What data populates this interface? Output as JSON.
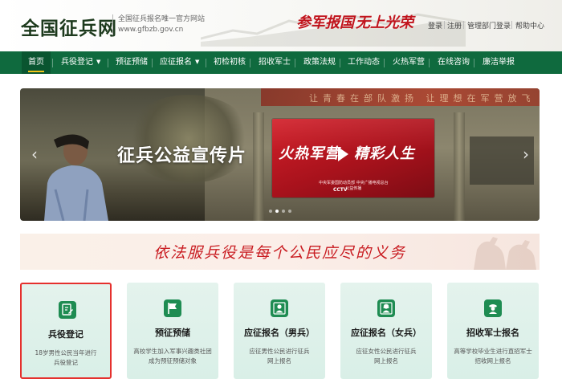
{
  "header": {
    "logo": "全国征兵网",
    "site_desc": "全国征兵报名唯一官方网站",
    "site_url": "www.gfbzb.gov.cn",
    "slogan_1": "参军报国",
    "slogan_2": "无上光荣",
    "links": [
      "登录",
      "注册",
      "管理部门登录",
      "帮助中心"
    ]
  },
  "nav": {
    "items": [
      "首页",
      "兵役登记",
      "预征预储",
      "应征报名",
      "初检初核",
      "招收军士",
      "政策法规",
      "工作动态",
      "火热军营",
      "在线咨询",
      "廉洁举报"
    ],
    "active_index": 0,
    "dropdown_items": [
      "兵役登记",
      "应征报名"
    ]
  },
  "banner": {
    "title": "征兵公益宣传片",
    "promo_title_1": "火热军营",
    "promo_title_2": "精彩人生",
    "promo_credit": "中央军委国防动员部 中央广播电视总台",
    "promo_credit_2": "公益传播",
    "promo_channel": "CCTV",
    "wall_text": "让青春在部队激扬  让理想在军营放飞",
    "slide_count": 4,
    "active_slide": 1
  },
  "band": {
    "text": "依法服兵役是每个公民应尽的义务"
  },
  "cards": [
    {
      "title": "兵役登记",
      "desc_1": "18岁男性公民当年进行",
      "desc_2": "兵役登记",
      "icon": "edit-document-icon",
      "selected": true
    },
    {
      "title": "预征预储",
      "desc_1": "高校学生加入军事兴趣类社团",
      "desc_2": "成为预征预储对象",
      "icon": "flag-icon",
      "selected": false
    },
    {
      "title": "应征报名（男兵）",
      "desc_1": "应征男性公民进行征兵",
      "desc_2": "网上报名",
      "icon": "male-user-icon",
      "selected": false
    },
    {
      "title": "应征报名（女兵）",
      "desc_1": "应征女性公民进行征兵",
      "desc_2": "网上报名",
      "icon": "female-user-icon",
      "selected": false
    },
    {
      "title": "招收军士报名",
      "desc_1": "高等学校毕业生进行直招军士",
      "desc_2": "招收网上报名",
      "icon": "soldier-icon",
      "selected": false
    }
  ],
  "colors": {
    "nav_green": "#0f6a3e",
    "brand_red": "#c91d22",
    "card_bg": "#e4f3ed",
    "icon_green": "#1e8c52",
    "selected_border": "#e5302d"
  }
}
